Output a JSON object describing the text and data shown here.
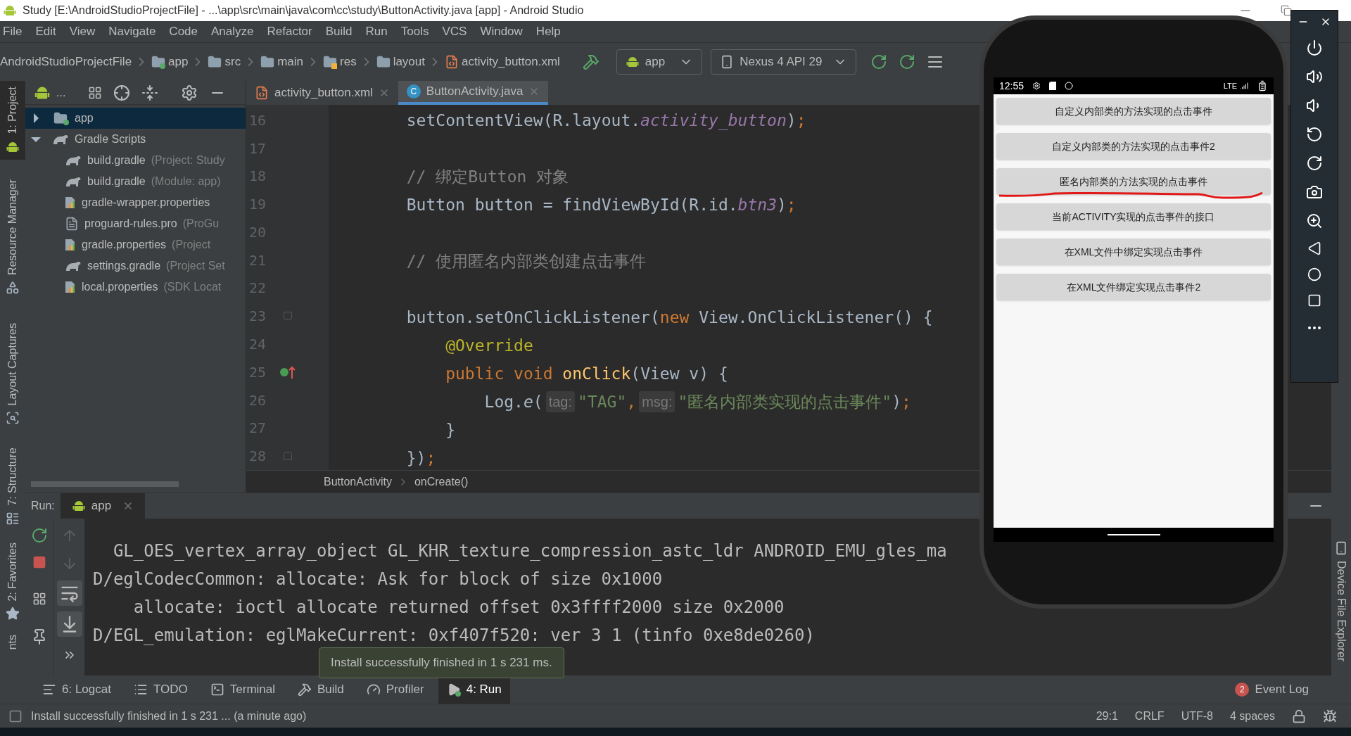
{
  "window": {
    "title": "Study [E:\\AndroidStudioProjectFile] - ...\\app\\src\\main\\java\\com\\cc\\study\\ButtonActivity.java [app] - Android Studio"
  },
  "menu": [
    "File",
    "Edit",
    "View",
    "Navigate",
    "Code",
    "Analyze",
    "Refactor",
    "Build",
    "Run",
    "Tools",
    "VCS",
    "Window",
    "Help"
  ],
  "breadcrumbs": [
    {
      "label": "AndroidStudioProjectFile",
      "kind": "project"
    },
    {
      "label": "app",
      "kind": "module"
    },
    {
      "label": "src",
      "kind": "folder"
    },
    {
      "label": "main",
      "kind": "folder"
    },
    {
      "label": "res",
      "kind": "res"
    },
    {
      "label": "layout",
      "kind": "layout"
    },
    {
      "label": "activity_button.xml",
      "kind": "xml"
    }
  ],
  "run_config": "app",
  "device": "Nexus 4 API 29",
  "left_strip": [
    {
      "label": "1: Project",
      "kind": "project",
      "selected": true
    },
    {
      "label": "Resource Manager",
      "kind": "resources",
      "selected": false
    },
    {
      "label": "Layout Captures",
      "kind": "captures",
      "selected": false
    },
    {
      "label": "7: Structure",
      "kind": "structure",
      "selected": false
    },
    {
      "label": "2: Favorites",
      "kind": "favorites",
      "selected": false
    },
    {
      "label": "nts",
      "kind": "plain",
      "selected": false
    }
  ],
  "project_panel": {
    "view_label": "...",
    "tree": [
      {
        "label": "app",
        "kind": "module",
        "expanded": false,
        "selected": true
      },
      {
        "label": "Gradle Scripts",
        "kind": "gradle",
        "expanded": true,
        "selected": false,
        "children": [
          {
            "label": "build.gradle",
            "hint": "(Project: Study",
            "kind": "gradle",
            "selected": false
          },
          {
            "label": "build.gradle",
            "hint": "(Module: app)",
            "kind": "gradle",
            "selected": false
          },
          {
            "label": "gradle-wrapper.properties",
            "kind": "properties",
            "selected": false
          },
          {
            "label": "proguard-rules.pro",
            "hint": "(ProGu",
            "kind": "text",
            "selected": false
          },
          {
            "label": "gradle.properties",
            "hint": "(Project",
            "kind": "properties",
            "selected": false
          },
          {
            "label": "settings.gradle",
            "hint": "(Project Set",
            "kind": "gradle",
            "selected": false
          },
          {
            "label": "local.properties",
            "hint": "(SDK Locat",
            "kind": "properties",
            "selected": false
          }
        ]
      }
    ]
  },
  "tabs": [
    {
      "label": "activity_button.xml",
      "kind": "xml",
      "selected": false
    },
    {
      "label": "ButtonActivity.java",
      "kind": "class",
      "icon_letter": "C",
      "selected": true
    }
  ],
  "code": [
    {
      "number": "16",
      "tokens": [
        {
          "text": "        setContentView(R.layout.",
          "kind": "plain"
        },
        {
          "text": "activity_button",
          "kind": "field"
        },
        {
          "text": ")",
          "kind": "plain"
        },
        {
          "text": ";",
          "kind": "punct"
        }
      ]
    },
    {
      "number": "17"
    },
    {
      "number": "18",
      "tokens": [
        {
          "text": "        // 绑定Button 对象",
          "kind": "comment"
        }
      ]
    },
    {
      "number": "19",
      "tokens": [
        {
          "text": "        Button button = findViewById(R.id.",
          "kind": "plain"
        },
        {
          "text": "btn3",
          "kind": "field"
        },
        {
          "text": ")",
          "kind": "plain"
        },
        {
          "text": ";",
          "kind": "punct"
        }
      ]
    },
    {
      "number": "20"
    },
    {
      "number": "21",
      "tokens": [
        {
          "text": "        // 使用匿名内部类创建点击事件",
          "kind": "comment"
        }
      ]
    },
    {
      "number": "22"
    },
    {
      "number": "23",
      "kind": "fold-start",
      "tokens": [
        {
          "text": "        button.setOnClickListener(",
          "kind": "plain"
        },
        {
          "text": "new",
          "kind": "keyword"
        },
        {
          "text": " View.OnClickListener() {",
          "kind": "plain"
        }
      ]
    },
    {
      "number": "24",
      "tokens": [
        {
          "text": "            @Override",
          "kind": "annotation"
        }
      ]
    },
    {
      "number": "25",
      "kind": "override",
      "tokens": [
        {
          "text": "            public void ",
          "kind": "keyword"
        },
        {
          "text": "onClick",
          "kind": "method"
        },
        {
          "text": "(View v) {",
          "kind": "plain"
        }
      ]
    },
    {
      "number": "26",
      "tokens": [
        {
          "text": "                Log.",
          "kind": "plain"
        },
        {
          "text": "e",
          "kind": "static"
        },
        {
          "text": "(",
          "kind": "plain"
        },
        {
          "text": "tag:",
          "kind": "hint"
        },
        {
          "text": "\"TAG\"",
          "kind": "string"
        },
        {
          "text": ",",
          "kind": "punct"
        },
        {
          "text": "msg:",
          "kind": "hint"
        },
        {
          "text": "\"匿名内部类实现的点击事件\"",
          "kind": "string"
        },
        {
          "text": ")",
          "kind": "plain"
        },
        {
          "text": ";",
          "kind": "punct"
        }
      ]
    },
    {
      "number": "27",
      "tokens": [
        {
          "text": "            }",
          "kind": "plain"
        }
      ]
    },
    {
      "number": "28",
      "kind": "fold-end",
      "tokens": [
        {
          "text": "        })",
          "kind": "plain"
        },
        {
          "text": ";",
          "kind": "punct"
        }
      ]
    }
  ],
  "editor_breadcrumbs": [
    "ButtonActivity",
    "onCreate()"
  ],
  "run_panel": {
    "title": "Run:",
    "tab": "app",
    "console": [
      "  GL_OES_vertex_array_object GL_KHR_texture_compression_astc_ldr ANDROID_EMU_gles_ma",
      "D/eglCodecCommon: allocate: Ask for block of size 0x1000",
      "    allocate: ioctl allocate returned offset 0x3ffff2000 size 0x2000",
      "D/EGL_emulation: eglMakeCurrent: 0xf407f520: ver 3 1 (tinfo 0xe8de0260)"
    ]
  },
  "tooltip": "Install successfully finished in 1 s 231 ms.",
  "tool_tabs": [
    {
      "label": "6: Logcat",
      "kind": "logcat",
      "selected": false
    },
    {
      "label": "TODO",
      "kind": "todo",
      "selected": false
    },
    {
      "label": "Terminal",
      "kind": "terminal",
      "selected": false
    },
    {
      "label": "Build",
      "kind": "build",
      "selected": false
    },
    {
      "label": "Profiler",
      "kind": "profiler",
      "selected": false
    },
    {
      "label": "4: Run",
      "kind": "run",
      "selected": true
    }
  ],
  "event_log": {
    "label": "Event Log",
    "count": "2"
  },
  "right_strip": [
    {
      "label": "Device File Explorer"
    }
  ],
  "status_bar": {
    "message": "Install successfully finished in 1 s 231 ... (a minute ago)",
    "position": "29:1",
    "line_ending": "CRLF",
    "encoding": "UTF-8",
    "indent": "4 spaces"
  },
  "emulator": {
    "time": "12:55",
    "network": "LTE",
    "buttons": [
      {
        "label": "自定义内部类的方法实现的点击事件",
        "underlined": false
      },
      {
        "label": "自定义内部类的方法实现的点击事件2",
        "underlined": false
      },
      {
        "label": "匿名内部类的方法实现的点击事件",
        "underlined": true
      },
      {
        "label": "当前ACTIVITY实现的点击事件的接口",
        "underlined": false
      },
      {
        "label": "在XML文件中绑定实现点击事件",
        "underlined": false
      },
      {
        "label": "在XML文件绑定实现点击事件2",
        "underlined": false
      }
    ]
  }
}
